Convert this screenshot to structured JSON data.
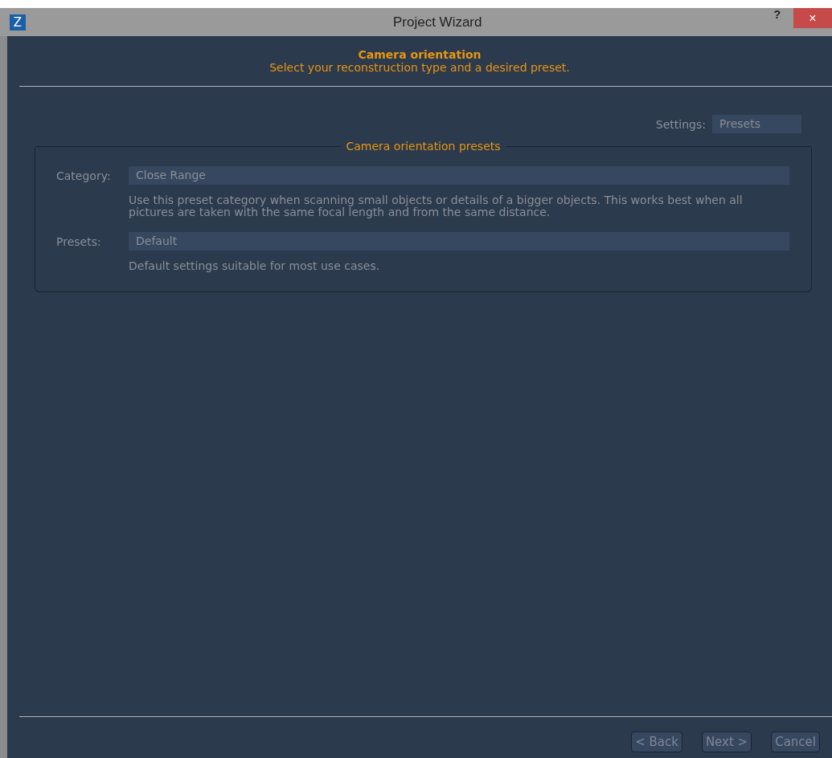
{
  "window": {
    "title": "Project Wizard",
    "app_icon": "Z",
    "help": "?",
    "close": "×"
  },
  "header": {
    "title": "Camera orientation",
    "subtitle": "Select your reconstruction type and a desired preset."
  },
  "settings": {
    "label": "Settings:",
    "value": "Presets"
  },
  "group": {
    "title": "Camera orientation presets",
    "fields": [
      {
        "label": "Category:",
        "value": "Close Range",
        "description": "Use this preset category when scanning small objects or details of a bigger objects. This works best when all pictures are taken with the same focal length and from the same distance."
      },
      {
        "label": "Presets:",
        "value": "Default",
        "description": "Default settings suitable for most use cases."
      }
    ]
  },
  "buttons": [
    "< Back",
    "Next >",
    "Cancel"
  ]
}
